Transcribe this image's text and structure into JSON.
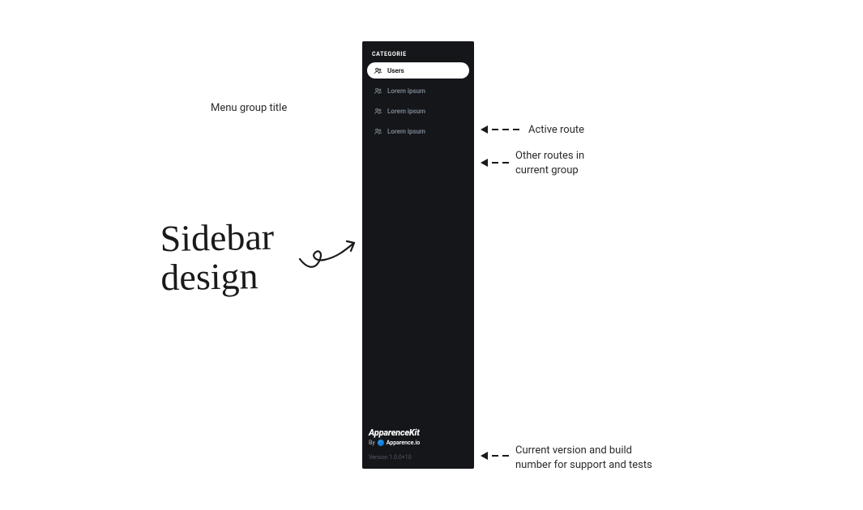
{
  "annotations": {
    "menu_group_title": "Menu group title",
    "active_route": "Active route",
    "other_routes": "Other routes in\ncurrent group",
    "version_note": "Current version and build\nnumber for support and tests",
    "handwritten": "Sidebar\ndesign"
  },
  "sidebar": {
    "category_title": "CATEGORIE",
    "items": [
      {
        "label": "Users",
        "active": true
      },
      {
        "label": "Lorem ipsum",
        "active": false
      },
      {
        "label": "Lorem ipsum",
        "active": false
      },
      {
        "label": "Lorem ipsum",
        "active": false
      }
    ],
    "footer": {
      "brand": "ApparenceKit",
      "byline_prefix": "By",
      "byline_name": "Apparence.io",
      "version": "Version 1.0.0+10"
    }
  }
}
